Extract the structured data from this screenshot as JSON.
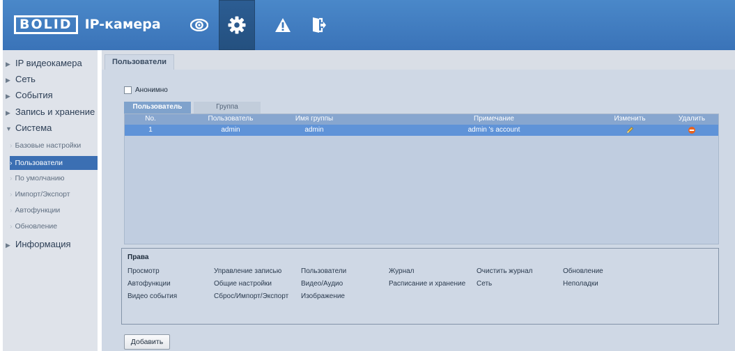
{
  "header": {
    "logo_text": "BOLID",
    "app_title": "IP-камера",
    "icons": [
      "eye-icon",
      "gear-icon",
      "warning-icon",
      "logout-icon"
    ]
  },
  "sidebar": {
    "items": [
      {
        "label": "IP видеокамера",
        "expanded": false
      },
      {
        "label": "Сеть",
        "expanded": false
      },
      {
        "label": "События",
        "expanded": false
      },
      {
        "label": "Запись и хранение",
        "expanded": false
      },
      {
        "label": "Система",
        "expanded": true
      },
      {
        "label": "Информация",
        "expanded": false
      }
    ],
    "subitems": [
      {
        "label": "Базовые настройки",
        "active": false
      },
      {
        "label": "Пользователи",
        "active": true
      },
      {
        "label": "По умолчанию",
        "active": false
      },
      {
        "label": "Импорт/Экспорт",
        "active": false
      },
      {
        "label": "Автофункции",
        "active": false
      },
      {
        "label": "Обновление",
        "active": false
      }
    ]
  },
  "main": {
    "page_tab": "Пользователи",
    "anonymous_label": "Анонимно",
    "anonymous_checked": false,
    "subtabs": [
      "Пользователь",
      "Группа"
    ],
    "columns": [
      "No.",
      "Пользователь",
      "Имя группы",
      "Примечание",
      "Изменить",
      "Удалить"
    ],
    "rows": [
      {
        "no": "1",
        "user": "admin",
        "group": "admin",
        "note": "admin 's account"
      }
    ],
    "rights": {
      "title": "Права",
      "items": [
        [
          "Просмотр",
          "Управление записью",
          "Пользователи",
          "Журнал",
          "Очистить журнал",
          "Обновление"
        ],
        [
          "Автофункции",
          "Общие настройки",
          "Видео/Аудио",
          "Расписание и хранение",
          "Сеть",
          "Неполадки"
        ],
        [
          "Видео события",
          "Сброс/Импорт/Экспорт",
          "Изображение"
        ]
      ]
    },
    "add_button": "Добавить"
  },
  "colors": {
    "header_blue": "#3f7cc0",
    "table_header": "#87a6cf",
    "selected_row": "#5f93d8",
    "active_nav": "#3b6fb3",
    "edit_icon": "#d9b04a",
    "delete_icon": "#e8631f"
  }
}
